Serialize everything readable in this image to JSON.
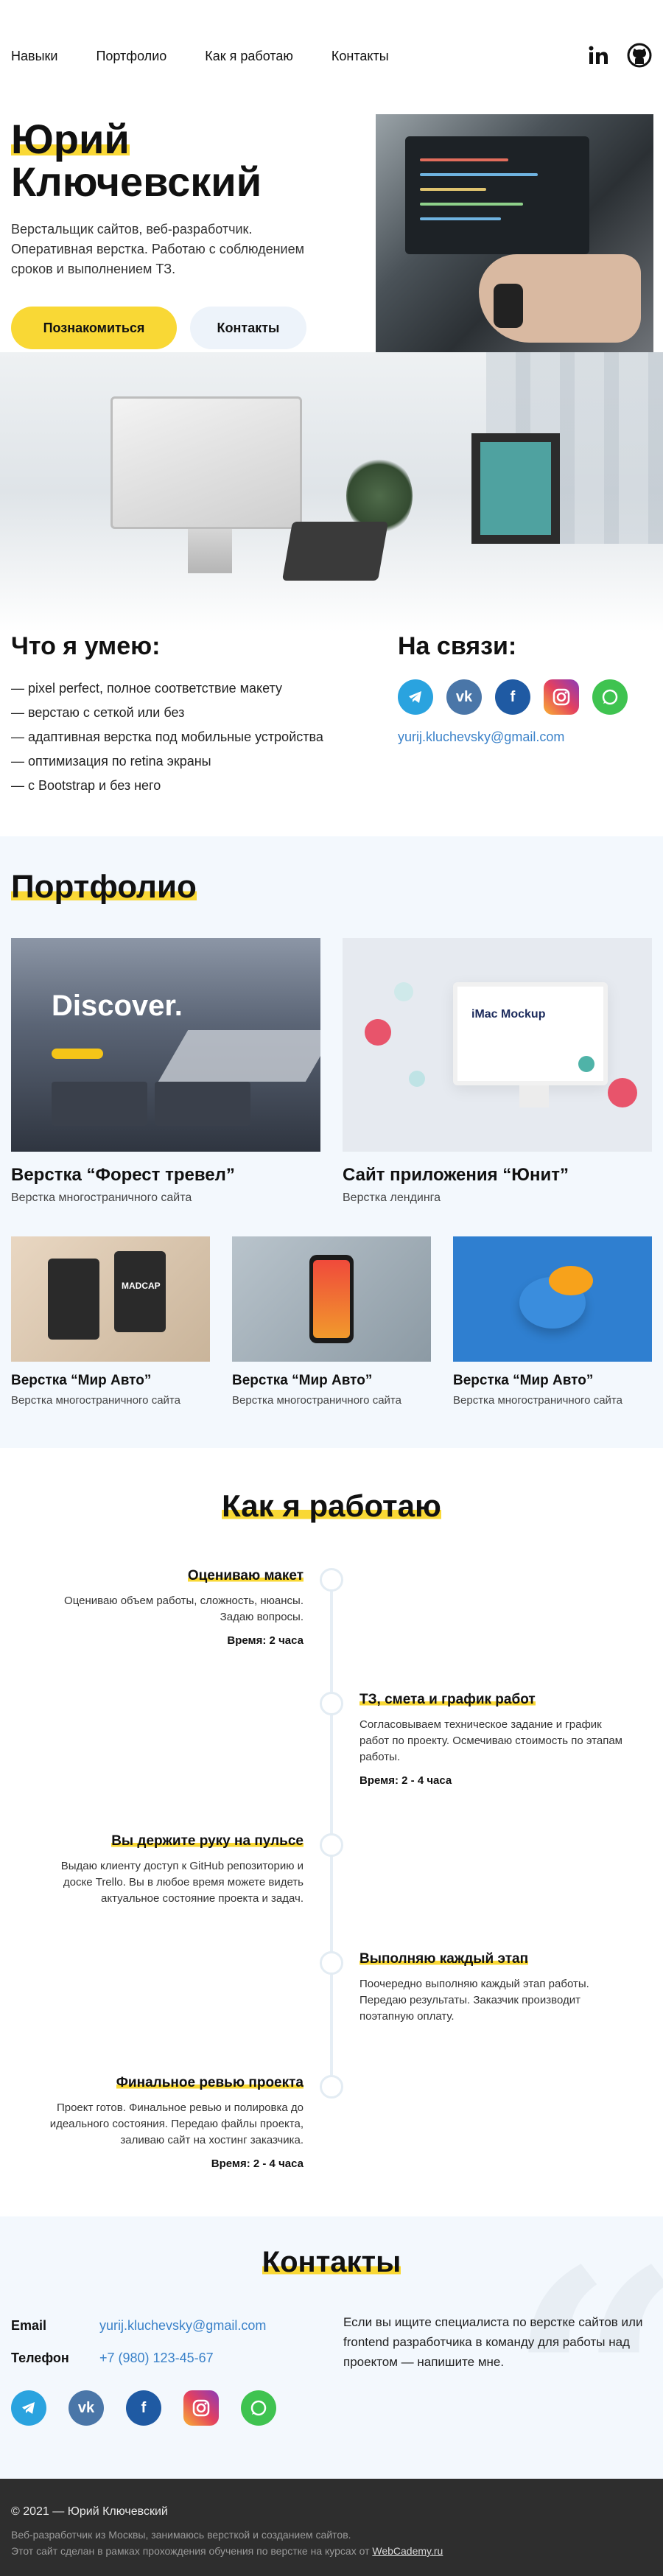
{
  "nav": {
    "links": [
      "Навыки",
      "Портфолио",
      "Как я работаю",
      "Контакты"
    ],
    "social_icons": [
      "linkedin-icon",
      "github-icon"
    ]
  },
  "hero": {
    "title_line1": "Юрий",
    "title_line2": "Ключевский",
    "text": "Верстальщик сайтов, веб-разработчик. Оперативная верстка. Работаю с соблюдением сроков и выполнением ТЗ.",
    "btn_primary": "Познакомиться",
    "btn_secondary": "Контакты"
  },
  "skills": {
    "title": "Что я умею:",
    "items": [
      "— pixel perfect, полное соответствие макету",
      "— верстаю с сеткой или без",
      "— адаптивная верстка под мобильные устройства",
      "— оптимизация по retina экраны",
      "— с Bootstrap и без него"
    ]
  },
  "contact_block": {
    "title": "На связи:",
    "email": "yurij.kluchevsky@gmail.com",
    "icons": [
      "telegram-icon",
      "vk-icon",
      "facebook-icon",
      "instagram-icon",
      "whatsapp-icon"
    ]
  },
  "portfolio": {
    "title": "Портфолио",
    "big": [
      {
        "title": "Верстка “Форест тревел”",
        "sub": "Верстка многостраничного сайта",
        "thumb_text": "Discover."
      },
      {
        "title": "Сайт приложения “Юнит”",
        "sub": "Верстка лендинга",
        "thumb_text": "iMac Mockup"
      }
    ],
    "small": [
      {
        "title": "Верстка “Мир Авто”",
        "sub": "Верстка многостраничного сайта",
        "thumb_text": "MADCAP"
      },
      {
        "title": "Верстка “Мир Авто”",
        "sub": "Верстка многостраничного сайта"
      },
      {
        "title": "Верстка “Мир Авто”",
        "sub": "Верстка многостраничного сайта"
      }
    ]
  },
  "how": {
    "title": "Как я работаю",
    "steps": [
      {
        "title": "Оцениваю макет",
        "text": "Оцениваю объем работы, сложность, нюансы. Задаю вопросы.",
        "time": "Время: 2 часа"
      },
      {
        "title": "ТЗ, смета и график работ",
        "text": "Согласовываем техническое задание и график работ по проекту. Осмечиваю стоимость по этапам работы.",
        "time": "Время: 2 - 4 часа"
      },
      {
        "title": "Вы держите руку на пульсе",
        "text": "Выдаю клиенту доступ к GitHub репозиторию и доске Trello. Вы в любое время можете видеть актуальное состояние проекта и задач.",
        "time": ""
      },
      {
        "title": "Выполняю каждый этап",
        "text": "Поочередно выполняю каждый этап работы. Передаю результаты. Заказчик производит поэтапную оплату.",
        "time": ""
      },
      {
        "title": "Финальное ревью проекта",
        "text": "Проект готов. Финальное ревью и полировка до идеального состояния. Передаю файлы проекта, заливаю сайт на хостинг заказчика.",
        "time": "Время: 2 - 4 часа"
      }
    ]
  },
  "contacts": {
    "title": "Контакты",
    "email_label": "Email",
    "email": "yurij.kluchevsky@gmail.com",
    "phone_label": "Телефон",
    "phone": "+7 (980) 123-45-67",
    "text": "Если вы ищите специалиста по верстке сайтов или frontend разработчика в команду для работы над проектом — напишите мне."
  },
  "footer": {
    "copyright": "© 2021 — Юрий Ключевский",
    "line1": "Веб-разработчик из Москвы, занимаюсь версткой и созданием сайтов.",
    "line2_prefix": "Этот сайт сделан в рамках прохождения обучения по верстке на курсах от ",
    "line2_link": "WebCademy.ru"
  },
  "colors": {
    "accent": "#f9d835",
    "link": "#3b82c9",
    "section_bg": "#f3f8fd",
    "footer_bg": "#2e2e2e"
  }
}
